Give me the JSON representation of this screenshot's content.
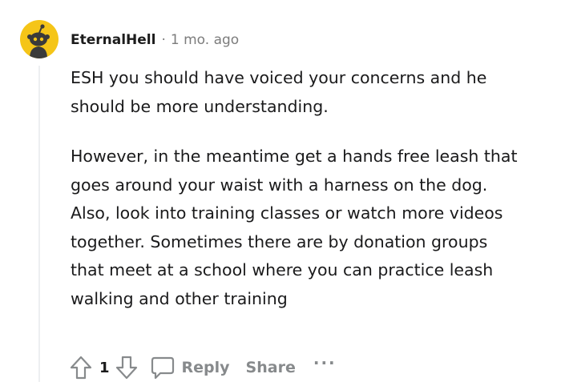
{
  "comment": {
    "author": "EternalHell",
    "separator": "·",
    "time_ago": "1 mo. ago",
    "paragraphs": [
      "ESH you should have voiced your concerns and he should be more understanding.",
      "However, in the meantime get a hands free leash that goes around your waist with a harness on the dog. Also, look into training classes or watch more videos together. Sometimes there are by donation groups that meet at a school where you can practice leash walking and other training"
    ],
    "vote_count": "1",
    "actions": {
      "reply_label": "Reply",
      "share_label": "Share",
      "more_label": "···"
    }
  },
  "colors": {
    "avatar_bg": "#f5c518",
    "text": "#1a1a1b",
    "meta": "#7c7c7c",
    "action": "#878a8c",
    "thread_line": "#edeff1"
  },
  "icons": {
    "avatar": "snoo-avatar-icon",
    "upvote": "upvote-arrow-icon",
    "downvote": "downvote-arrow-icon",
    "reply": "comment-bubble-icon"
  }
}
